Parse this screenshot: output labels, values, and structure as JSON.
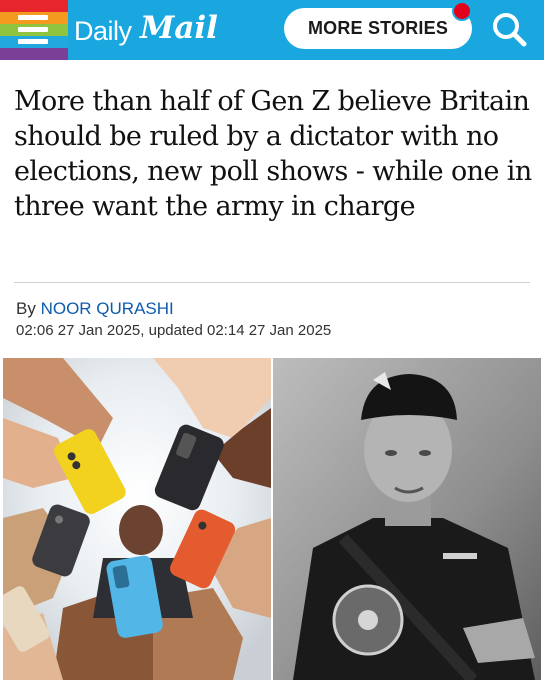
{
  "header": {
    "brand_daily": "Daily",
    "brand_mail": "Mail",
    "more_stories_label": "MORE STORIES",
    "colors": {
      "header_bg": "#1aa7e0",
      "notification": "#e3001b"
    },
    "icons": [
      "menu-icon",
      "search-icon"
    ]
  },
  "article": {
    "headline": "More than half of Gen Z believe Britain should be ruled by a dictator with no elections, new poll shows - while one in three want the army in charge",
    "byline_prefix": "By",
    "author": "NOOR QURASHI",
    "dateline": "02:06 27 Jan 2025, updated 02:14 27 Jan 2025",
    "colors": {
      "author_link": "#0c5cad"
    }
  },
  "images": {
    "left": "young-people-holding-smartphones-photo",
    "right": "dictator-black-and-white-portrait-photo"
  }
}
